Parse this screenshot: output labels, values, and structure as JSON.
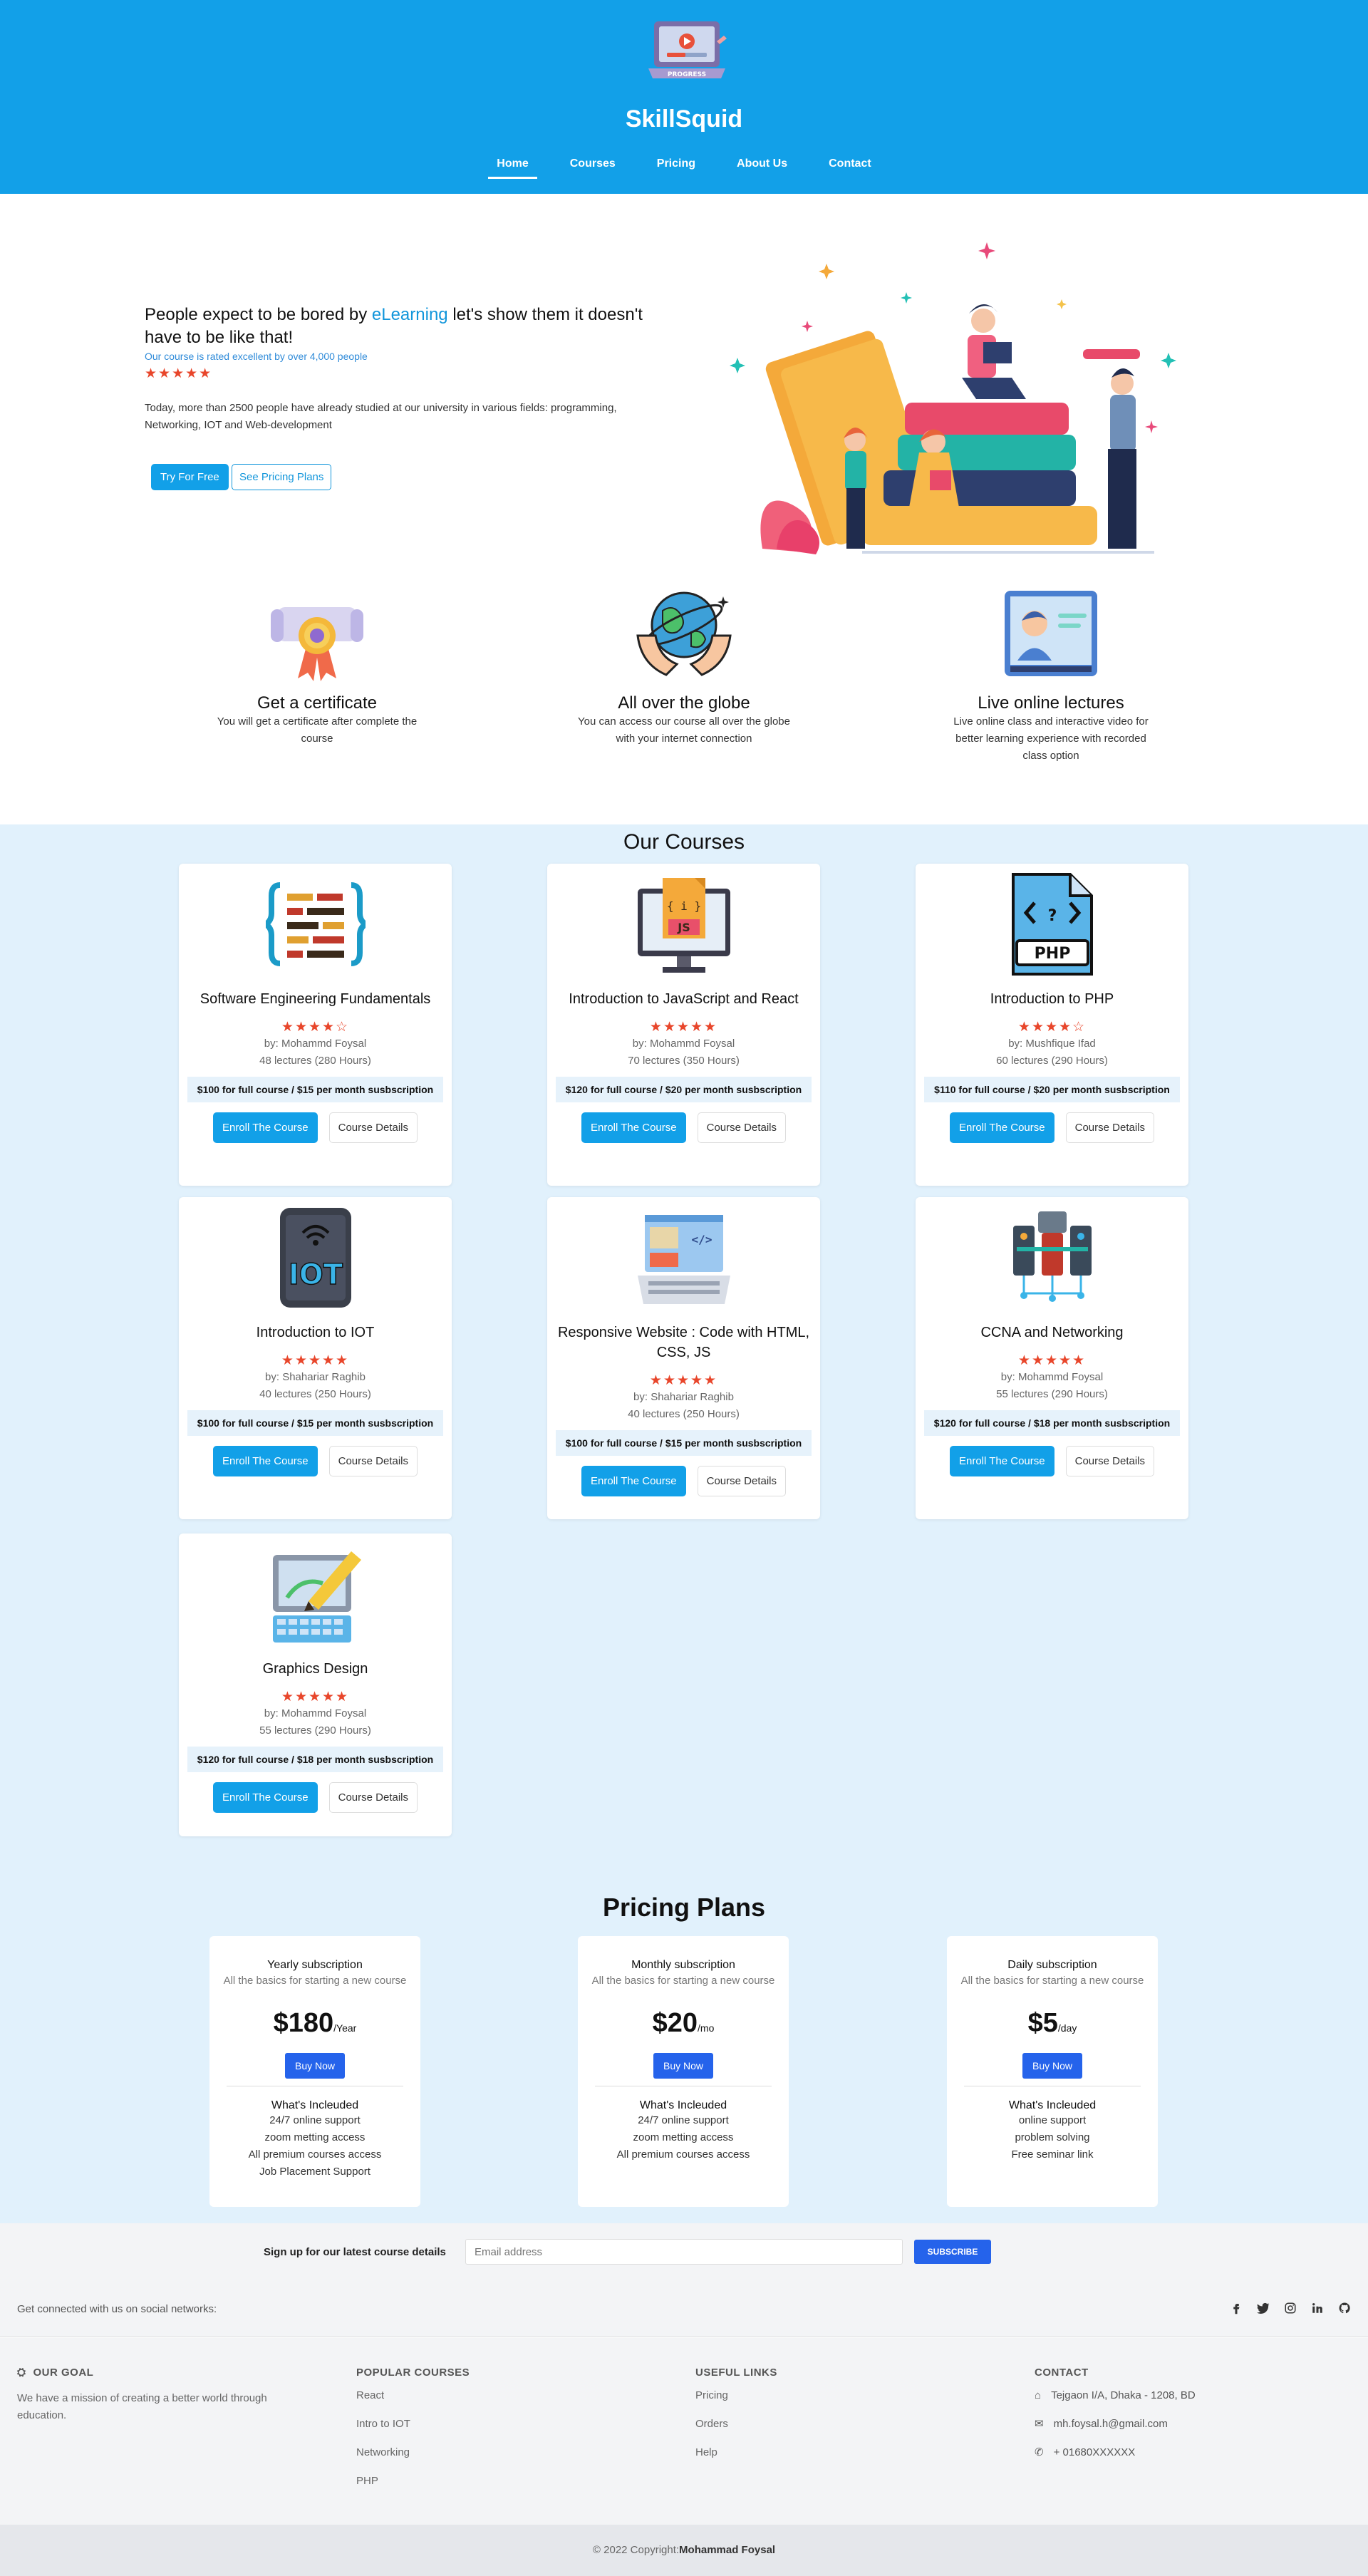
{
  "header": {
    "brand": "SkillSquid",
    "nav": [
      "Home",
      "Courses",
      "Pricing",
      "About Us",
      "Contact"
    ],
    "logo_text": "PROGRESS"
  },
  "hero": {
    "title_pre": "People expect to be bored by ",
    "title_highlight": "eLearning",
    "title_post": " let's show them it doesn't have to be like that!",
    "rated": "Our course is rated excellent by over 4,000 people",
    "stars": "★★★★★",
    "description": "Today, more than 2500 people have already studied at our university in various fields: programming, Networking, IOT and Web-development",
    "btn_primary": "Try For Free",
    "btn_secondary": "See Pricing Plans"
  },
  "features": [
    {
      "title": "Get a certificate",
      "text": "You will get a certificate after complete the course"
    },
    {
      "title": "All over the globe",
      "text": "You can access our course all over the globe with your internet connection"
    },
    {
      "title": "Live online lectures",
      "text": "Live online class and interactive video for better learning experience with recorded class option"
    }
  ],
  "courses": {
    "heading": "Our Courses",
    "enroll_label": "Enroll The Course",
    "details_label": "Course Details",
    "items": [
      {
        "title": "Software Engineering Fundamentals",
        "stars": "★★★★☆",
        "by": "by: Mohammd Foysal",
        "lectures": "48 lectures (280 Hours)",
        "price": "$100 for full course / $15 per month susbscription"
      },
      {
        "title": "Introduction to JavaScript and React",
        "stars": "★★★★★",
        "by": "by: Mohammd Foysal",
        "lectures": "70 lectures (350 Hours)",
        "price": "$120 for full course / $20 per month susbscription"
      },
      {
        "title": "Introduction to PHP",
        "stars": "★★★★☆",
        "by": "by: Mushfique Ifad",
        "lectures": "60 lectures (290 Hours)",
        "price": "$110 for full course / $20 per month susbscription"
      },
      {
        "title": "Introduction to IOT",
        "stars": "★★★★★",
        "by": "by: Shahariar Raghib",
        "lectures": "40 lectures (250 Hours)",
        "price": "$100 for full course / $15 per month susbscription"
      },
      {
        "title": "Responsive Website : Code with HTML, CSS, JS",
        "stars": "★★★★★",
        "by": "by: Shahariar Raghib",
        "lectures": "40 lectures (250 Hours)",
        "price": "$100 for full course / $15 per month susbscription"
      },
      {
        "title": "CCNA and Networking",
        "stars": "★★★★★",
        "by": "by: Mohammd Foysal",
        "lectures": "55 lectures (290 Hours)",
        "price": "$120 for full course / $18 per month susbscription"
      },
      {
        "title": "Graphics Design",
        "stars": "★★★★★",
        "by": "by: Mohammd Foysal",
        "lectures": "55 lectures (290 Hours)",
        "price": "$120 for full course / $18 per month susbscription"
      }
    ]
  },
  "pricing": {
    "heading": "Pricing Plans",
    "buy_label": "Buy Now",
    "included_label": "What's Incleuded",
    "plans": [
      {
        "name": "Yearly subscription",
        "sub": "All the basics for starting a new course",
        "amount": "$180",
        "per": "/Year",
        "features": [
          "24/7 online support",
          "zoom metting access",
          "All premium courses access",
          "Job Placement Support"
        ]
      },
      {
        "name": "Monthly subscription",
        "sub": "All the basics for starting a new course",
        "amount": "$20",
        "per": "/mo",
        "features": [
          "24/7 online support",
          "zoom metting access",
          "All premium courses access"
        ]
      },
      {
        "name": "Daily subscription",
        "sub": "All the basics for starting a new course",
        "amount": "$5",
        "per": "/day",
        "features": [
          "online support",
          "problem solving",
          "Free seminar link"
        ]
      }
    ]
  },
  "signup": {
    "label": "Sign up for our latest course details",
    "placeholder": "Email address",
    "button": "SUBSCRIBE"
  },
  "social": {
    "text": "Get connected with us on social networks:",
    "icons": [
      "facebook-icon",
      "twitter-icon",
      "instagram-icon",
      "linkedin-icon",
      "github-icon"
    ]
  },
  "footer": {
    "goal": {
      "heading": "OUR GOAL",
      "text": "We have a mission of creating a better world through education."
    },
    "popular": {
      "heading": "POPULAR COURSES",
      "links": [
        "React",
        "Intro to IOT",
        "Networking",
        "PHP"
      ]
    },
    "useful": {
      "heading": "USEFUL LINKS",
      "links": [
        "Pricing",
        "Orders",
        "Help"
      ]
    },
    "contact": {
      "heading": "CONTACT",
      "address": "Tejgaon I/A, Dhaka - 1208, BD",
      "email": "mh.foysal.h@gmail.com",
      "phone": "+ 01680XXXXXX"
    }
  },
  "copyright": {
    "text": "© 2022 Copyright:",
    "name": "Mohammad Foysal"
  },
  "colors": {
    "primary": "#12a0e8",
    "light_bg": "#e1f1fc",
    "star": "#e8462b",
    "buy": "#2563eb"
  }
}
